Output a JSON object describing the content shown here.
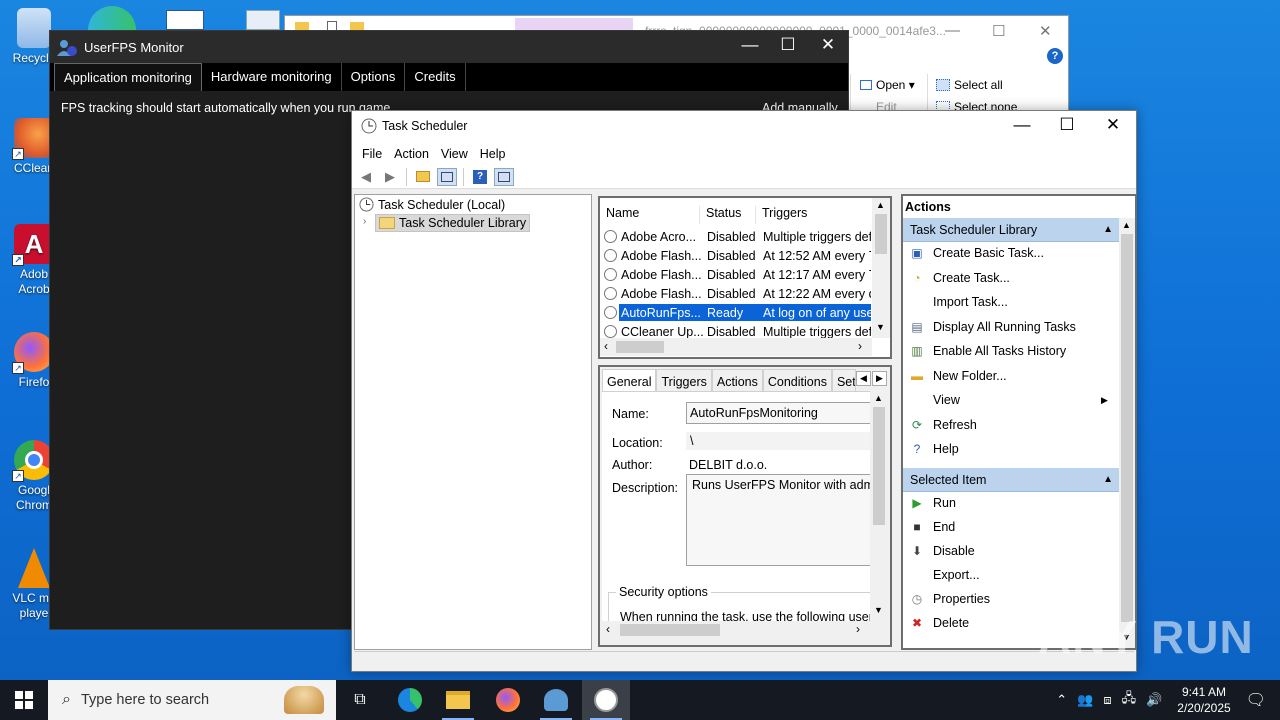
{
  "desktop": {
    "icons": [
      {
        "label": "Recycle",
        "color": "#8fb8e8"
      },
      {
        "label": "CClean",
        "color": "#e05a2a"
      },
      {
        "label": "Adob Acrob",
        "color": "#c8102e"
      },
      {
        "label": "Firefo",
        "color": "#ff7139"
      },
      {
        "label": "Googl Chrom",
        "color": "#34a853"
      },
      {
        "label": "VLC me playe",
        "color": "#f08a00"
      }
    ]
  },
  "explorer": {
    "title": "frrrs_tign_00000000000000000_0001_0000_0014afe3...",
    "open_label": "Open ▾",
    "edit_label": "Edit",
    "select_all_label": "Select all",
    "select_none_label": "Select none",
    "help_label": "?"
  },
  "userfps": {
    "title": "UserFPS Monitor",
    "tabs": [
      "Application monitoring",
      "Hardware monitoring",
      "Options",
      "Credits"
    ],
    "message": "FPS tracking should start automatically when you run game",
    "add_manually": "Add manually"
  },
  "taskscheduler": {
    "title": "Task Scheduler",
    "menu": [
      "File",
      "Action",
      "View",
      "Help"
    ],
    "tree": {
      "root": "Task Scheduler (Local)",
      "library": "Task Scheduler Library"
    },
    "columns": [
      "Name",
      "Status",
      "Triggers"
    ],
    "tasks": [
      {
        "name": "Adobe Acro...",
        "status": "Disabled",
        "triggers": "Multiple triggers defi"
      },
      {
        "name": "Adobe Flash...",
        "status": "Disabled",
        "triggers": "At 12:52 AM every 7"
      },
      {
        "name": "Adobe Flash...",
        "status": "Disabled",
        "triggers": "At 12:17 AM every 7"
      },
      {
        "name": "Adobe Flash...",
        "status": "Disabled",
        "triggers": "At 12:22 AM every da"
      },
      {
        "name": "AutoRunFps...",
        "status": "Ready",
        "triggers": "At log on of any user"
      },
      {
        "name": "CCleaner Up...",
        "status": "Disabled",
        "triggers": "Multiple triggers defi"
      }
    ],
    "detail_tabs": [
      "General",
      "Triggers",
      "Actions",
      "Conditions",
      "Sett"
    ],
    "general": {
      "name_label": "Name:",
      "name_value": "AutoRunFpsMonitoring",
      "location_label": "Location:",
      "location_value": "\\",
      "author_label": "Author:",
      "author_value": "DELBIT d.o.o.",
      "description_label": "Description:",
      "description_value": "Runs UserFPS Monitor with admin",
      "security_label": "Security options",
      "security_text": "When running the task, use the following user a"
    },
    "actions_header": "Actions",
    "library_section": "Task Scheduler Library",
    "library_actions": [
      {
        "label": "Create Basic Task...",
        "icon": "wizard-icon"
      },
      {
        "label": "Create Task...",
        "icon": "task-icon"
      },
      {
        "label": "Import Task...",
        "icon": ""
      },
      {
        "label": "Display All Running Tasks",
        "icon": "running-icon"
      },
      {
        "label": "Enable All Tasks History",
        "icon": "history-icon"
      },
      {
        "label": "New Folder...",
        "icon": "folder-icon"
      },
      {
        "label": "View",
        "icon": ""
      },
      {
        "label": "Refresh",
        "icon": "refresh-icon"
      },
      {
        "label": "Help",
        "icon": "help-icon"
      }
    ],
    "selected_section": "Selected Item",
    "selected_actions": [
      {
        "label": "Run",
        "icon": "run-icon"
      },
      {
        "label": "End",
        "icon": "end-icon"
      },
      {
        "label": "Disable",
        "icon": "disable-icon"
      },
      {
        "label": "Export...",
        "icon": ""
      },
      {
        "label": "Properties",
        "icon": "properties-icon"
      },
      {
        "label": "Delete",
        "icon": "delete-icon"
      }
    ]
  },
  "taskbar": {
    "search_placeholder": "Type here to search",
    "time": "9:41 AM",
    "date": "2/20/2025"
  },
  "watermark": "ANY RUN"
}
